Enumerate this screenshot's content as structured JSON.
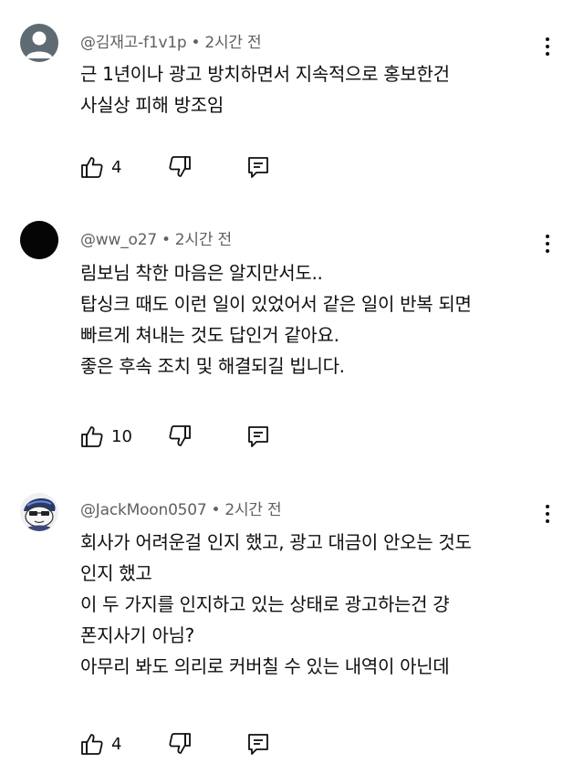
{
  "comments": [
    {
      "author": "@김재고-f1v1p",
      "separator": "•",
      "time": "2시간 전",
      "lines": [
        "근 1년이나 광고 방치하면서 지속적으로 홍보한건",
        "사실상 피해 방조임"
      ],
      "likes": "4",
      "avatar": "default-person-icon"
    },
    {
      "author": "@ww_o27",
      "separator": "•",
      "time": "2시간 전",
      "lines": [
        "림보님 착한 마음은 알지만서도..",
        "탑싱크 때도 이런 일이 있었어서 같은 일이 반복 되면",
        "빠르게 쳐내는 것도 답인거 같아요.",
        "좋은 후속 조치 및 해결되길 빕니다."
      ],
      "likes": "10",
      "avatar": "black-circle"
    },
    {
      "author": "@JackMoon0507",
      "separator": "•",
      "time": "2시간 전",
      "lines": [
        "회사가 어려운걸 인지 했고, 광고 대금이 안오는 것도",
        "인지 했고",
        "이 두 가지를 인지하고 있는 상태로 광고하는건 걍",
        "폰지사기 아님?",
        "아무리 봐도 의리로 커버칠 수 있는 내역이 아닌데"
      ],
      "likes": "4",
      "avatar": "cartoon-character-icon"
    }
  ],
  "icons": {
    "like": "thumbs-up-icon",
    "dislike": "thumbs-down-icon",
    "reply": "reply-icon",
    "menu": "more-vert-icon"
  },
  "colors": {
    "meta_text": "#606060",
    "body_text": "#0f0f0f",
    "default_avatar_bg": "#5f6b73"
  }
}
